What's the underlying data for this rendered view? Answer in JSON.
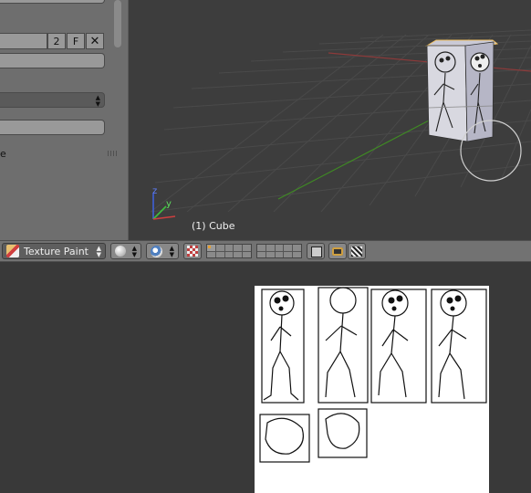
{
  "viewport": {
    "object_label": "(1) Cube",
    "panel": {
      "datablock_users": "2",
      "fake_user_label": "F",
      "unlink_icon": "x-icon",
      "truncated_label": "e"
    },
    "axis_labels": {
      "z": "z",
      "y": "y"
    }
  },
  "header": {
    "mode_label": "Texture Paint",
    "mode_icon": "brush-icon",
    "shading_icon": "sphere-icon",
    "pivot_icon": "pivot-icon",
    "texture_icon": "checker-icon",
    "lock_icon": "lock-camera-icon",
    "render_icon": "camera-icon",
    "anim_icon": "clapboard-icon"
  },
  "image_editor": {
    "texture_description": "stick-figure texture sheet"
  },
  "colors": {
    "panel": "#6e6e6e",
    "viewport_bg": "#3d3d3d",
    "grid_line": "#4a4a4a",
    "x_axis": "#8c3a3a",
    "y_axis": "#3f8a24",
    "header": "#727272",
    "editor_bg": "#393939"
  }
}
